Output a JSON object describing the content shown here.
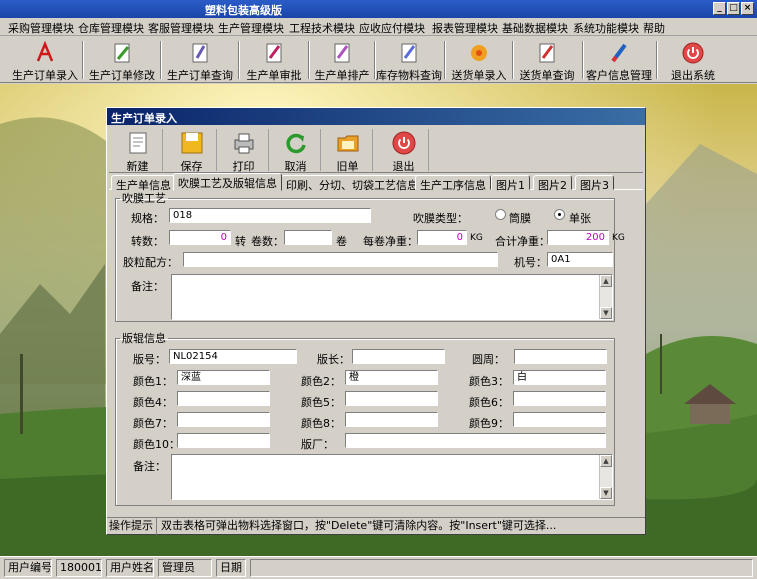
{
  "window": {
    "title": "塑料包装高级版"
  },
  "menu": [
    "采购管理模块",
    "仓库管理模块",
    "客服管理模块",
    "生产管理模块",
    "工程技术模块",
    "应收应付模块",
    "报表管理模块",
    "基础数据模块",
    "系统功能模块",
    "帮助"
  ],
  "toolbar": [
    "生产订单录入",
    "生产订单修改",
    "生产订单查询",
    "生产单审批",
    "生产单排产",
    "库存物料查询",
    "送货单录入",
    "送货单查询",
    "客户信息管理",
    "退出系统"
  ],
  "child": {
    "title": "生产订单录入",
    "buttons": [
      "新建",
      "保存",
      "打印",
      "取消",
      "旧单",
      "退出"
    ],
    "tabs": [
      "生产单信息",
      "吹膜工艺及版辊信息",
      "印刷、分切、切袋工艺信息",
      "生产工序信息",
      "图片1",
      "图片2",
      "图片3"
    ],
    "blow": {
      "legend": "吹膜工艺",
      "spec_label": "规格：",
      "spec_value": "018",
      "film_type_label": "吹膜类型：",
      "opt1": "筒膜",
      "opt2": "单张",
      "turns_label": "转数：",
      "turns_value": "0",
      "turns_unit": "转",
      "rolls_label": "卷数：",
      "rolls_unit": "卷",
      "net_label": "每卷净重：",
      "net_value": "0",
      "net_unit": "KG",
      "total_label": "合计净重：",
      "total_value": "200",
      "total_unit": "KG",
      "recipe_label": "胶粒配方：",
      "machine_label": "机号：",
      "machine_value": "0A1",
      "remark_label": "备注："
    },
    "plate": {
      "legend": "版辊信息",
      "no_label": "版号：",
      "no_value": "NL02154",
      "len_label": "版长：",
      "circ_label": "圆周：",
      "colors": [
        {
          "label": "颜色1：",
          "value": "深蓝"
        },
        {
          "label": "颜色2：",
          "value": "橙"
        },
        {
          "label": "颜色3：",
          "value": "白"
        },
        {
          "label": "颜色4：",
          "value": ""
        },
        {
          "label": "颜色5：",
          "value": ""
        },
        {
          "label": "颜色6：",
          "value": ""
        },
        {
          "label": "颜色7：",
          "value": ""
        },
        {
          "label": "颜色8：",
          "value": ""
        },
        {
          "label": "颜色9：",
          "value": ""
        },
        {
          "label": "颜色10：",
          "value": ""
        }
      ],
      "factory_label": "版厂：",
      "remark_label": "备注："
    },
    "hint_label": "操作提示",
    "hint_text": "双击表格可弹出物料选择窗口，按\"Delete\"键可清除内容。按\"Insert\"键可选择..."
  },
  "status": {
    "user_no_label": "用户编号",
    "user_no": "180001",
    "user_name_label": "用户姓名",
    "user_name": "管理员",
    "date_label": "日期"
  }
}
